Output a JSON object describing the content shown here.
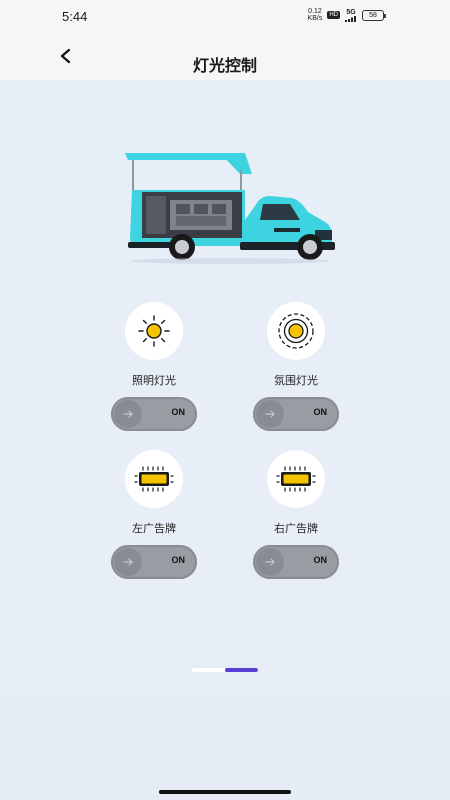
{
  "status": {
    "time": "5:44",
    "net_speed_value": "0.12",
    "net_speed_unit": "KB/s",
    "hd": "HD",
    "signal": "5G",
    "battery": "58"
  },
  "header": {
    "title": "灯光控制"
  },
  "lights": [
    {
      "label": "照明灯光",
      "state": "ON",
      "icon": "sun-icon"
    },
    {
      "label": "氛围灯光",
      "state": "ON",
      "icon": "ambient-light-icon"
    },
    {
      "label": "左广告牌",
      "state": "ON",
      "icon": "billboard-icon"
    },
    {
      "label": "右广告牌",
      "state": "ON",
      "icon": "billboard-icon"
    }
  ],
  "colors": {
    "accent": "#5a3fd6",
    "icon_yellow": "#f5c400",
    "toggle_bg": "#9a9ca3",
    "vehicle_body": "#3ed3e0"
  },
  "page_indicator": {
    "active_fraction": 0.5
  }
}
